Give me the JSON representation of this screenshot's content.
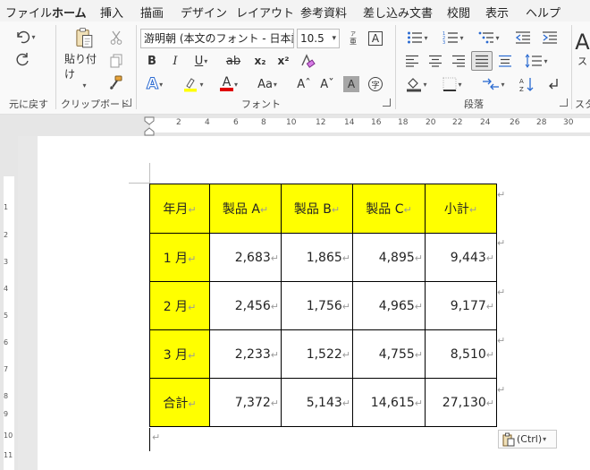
{
  "menu": {
    "tabs": [
      "ファイル",
      "ホーム",
      "挿入",
      "描画",
      "デザイン",
      "レイアウト",
      "参考資料",
      "差し込み文書",
      "校閲",
      "表示",
      "ヘルプ"
    ],
    "active_index": 1
  },
  "ribbon": {
    "undo": {
      "label": "元に戻す"
    },
    "clipboard": {
      "paste_label": "貼り付け",
      "label": "クリップボード"
    },
    "font": {
      "font_name": "游明朝 (本文のフォント - 日本語",
      "font_size": "10.5",
      "label": "フォント",
      "bold": "B",
      "italic": "I",
      "underline": "U",
      "strike": "ab",
      "subscript": "x₂",
      "superscript": "x²",
      "case": "Aa",
      "grow": "Aˆ",
      "shrink": "Aˇ",
      "shading_glyph": "A",
      "enclose_glyph": "字",
      "phonetic_glyph": "亜",
      "border_glyph": "A"
    },
    "paragraph": {
      "label": "段落"
    },
    "styles": {
      "label_fragment": "スタ",
      "button_fragment": "ス"
    }
  },
  "ruler": {
    "numbers": [
      "2",
      "4",
      "6",
      "8",
      "10",
      "12",
      "14",
      "16",
      "18",
      "20",
      "22",
      "24",
      "26",
      "28",
      "30"
    ]
  },
  "vruler": {
    "numbers": [
      "1",
      "2",
      "3",
      "4",
      "5",
      "6",
      "7",
      "8",
      "9",
      "10",
      "11"
    ]
  },
  "table": {
    "headers": [
      "年月",
      "製品 A",
      "製品 B",
      "製品 C",
      "小計"
    ],
    "rows": [
      {
        "month": "1 月",
        "a": "2,683",
        "b": "1,865",
        "c": "4,895",
        "subtotal": "9,443"
      },
      {
        "month": "2 月",
        "a": "2,456",
        "b": "1,756",
        "c": "4,965",
        "subtotal": "9,177"
      },
      {
        "month": "3 月",
        "a": "2,233",
        "b": "1,522",
        "c": "4,755",
        "subtotal": "8,510"
      },
      {
        "month": "合計",
        "a": "7,372",
        "b": "5,143",
        "c": "14,615",
        "subtotal": "27,130"
      }
    ]
  },
  "marks": {
    "paragraph": "↵"
  },
  "paste_options": {
    "label": "(Ctrl)"
  },
  "colors": {
    "menu_bg": "#f3f3f3",
    "ribbon_bg": "#f9f9f9",
    "accent": "#185abd",
    "highlight": "#ffff00",
    "font_color": "#e00000",
    "doc_bg": "#e8e8e8"
  }
}
